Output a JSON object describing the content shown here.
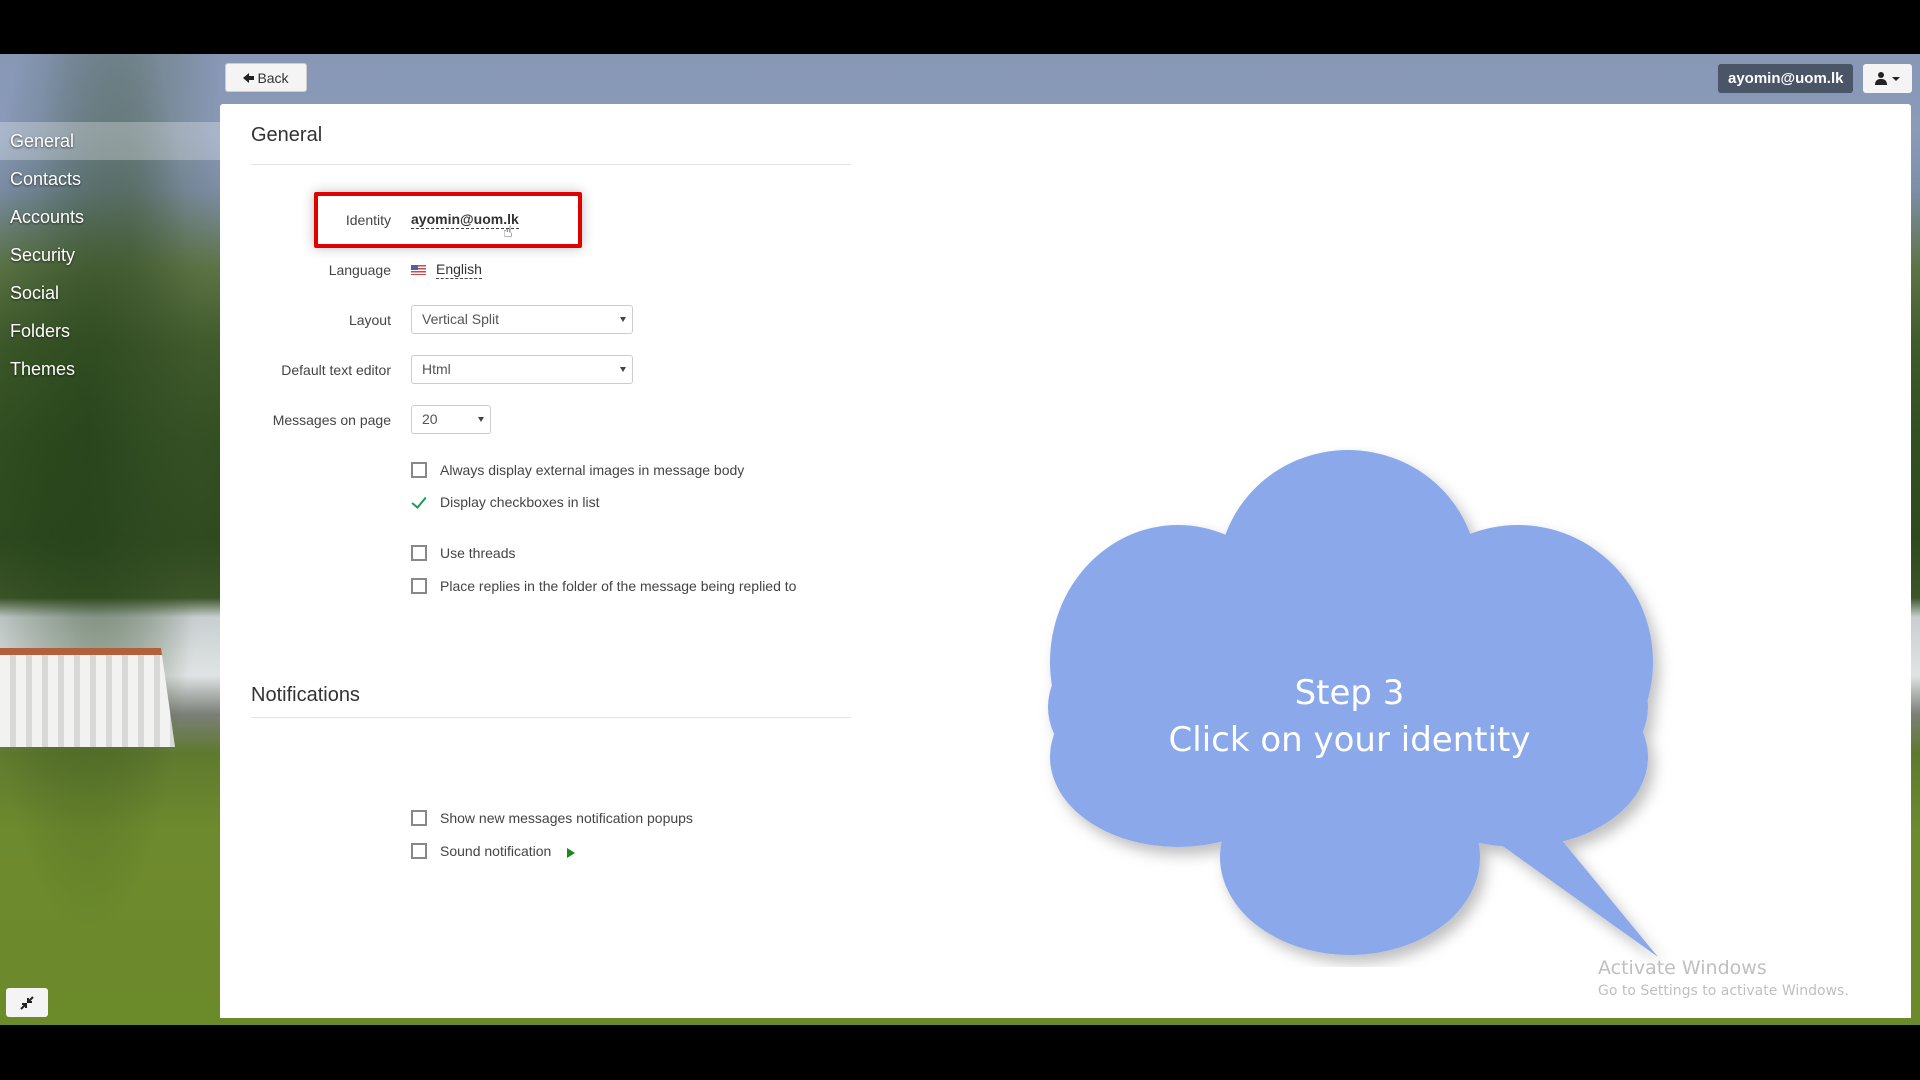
{
  "header": {
    "back_label": "Back",
    "user_email": "ayomin@uom.lk"
  },
  "sidebar": {
    "items": [
      {
        "label": "General",
        "active": true
      },
      {
        "label": "Contacts"
      },
      {
        "label": "Accounts"
      },
      {
        "label": "Security"
      },
      {
        "label": "Social"
      },
      {
        "label": "Folders"
      },
      {
        "label": "Themes"
      }
    ]
  },
  "general": {
    "title": "General",
    "identity_label": "Identity",
    "identity_value": "ayomin@uom.lk",
    "language_label": "Language",
    "language_value": "English",
    "layout_label": "Layout",
    "layout_value": "Vertical Split",
    "editor_label": "Default text editor",
    "editor_value": "Html",
    "messages_label": "Messages on page",
    "messages_value": "20",
    "options": [
      {
        "label": "Always display external images in message body",
        "checked": false
      },
      {
        "label": "Display checkboxes in list",
        "checked": true
      },
      {
        "label": "Use threads",
        "checked": false
      },
      {
        "label": "Place replies in the folder of the message being replied to",
        "checked": false
      }
    ]
  },
  "notifications": {
    "title": "Notifications",
    "options": [
      {
        "label": "Show new messages notification popups",
        "checked": false
      },
      {
        "label": "Sound notification",
        "checked": false
      }
    ]
  },
  "callout": {
    "line1": "Step 3",
    "line2": "Click on your identity",
    "color": "#8aa8ea"
  },
  "highlight_color": "#e00000",
  "watermark": {
    "line1": "Activate Windows",
    "line2": "Go to Settings to activate Windows."
  }
}
